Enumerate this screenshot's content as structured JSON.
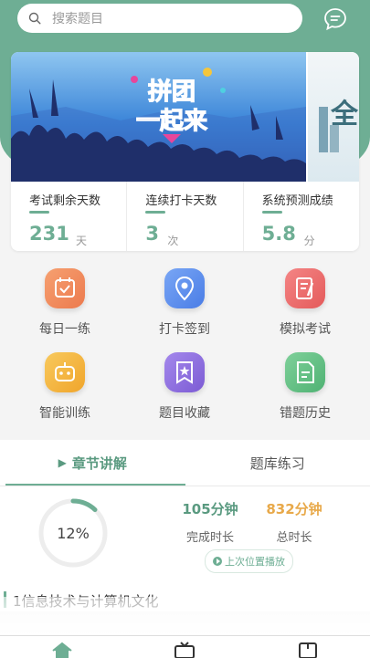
{
  "search": {
    "placeholder": "搜索题目"
  },
  "banner": {
    "line1": "拼团",
    "line2": "一起来",
    "side_text": "全"
  },
  "stats": [
    {
      "label": "考试剩余天数",
      "value": "231",
      "unit": "天"
    },
    {
      "label": "连续打卡天数",
      "value": "3",
      "unit": "次"
    },
    {
      "label": "系统预测成绩",
      "value": "5.8",
      "unit": "分"
    }
  ],
  "features": [
    {
      "label": "每日一练",
      "icon": "calendar-icon",
      "color": "#f08a5d"
    },
    {
      "label": "打卡签到",
      "icon": "location-pin-icon",
      "color": "#5b8def"
    },
    {
      "label": "模拟考试",
      "icon": "exam-paper-icon",
      "color": "#ef6b6b"
    },
    {
      "label": "智能训练",
      "icon": "robot-icon",
      "color": "#f5b53d"
    },
    {
      "label": "题目收藏",
      "icon": "bookmark-star-icon",
      "color": "#8a6bde"
    },
    {
      "label": "错题历史",
      "icon": "document-icon",
      "color": "#5cbf7e"
    }
  ],
  "tabs": [
    {
      "label": "章节讲解",
      "active": true
    },
    {
      "label": "题库练习",
      "active": false
    }
  ],
  "progress": {
    "percent_text": "12%",
    "percent": 12,
    "done_value": "105分钟",
    "done_label": "完成时长",
    "total_value": "832分钟",
    "total_label": "总时长",
    "resume_label": "上次位置播放"
  },
  "chapter": {
    "title": "1信息技术与计算机文化"
  },
  "colors": {
    "accent": "#6eae94",
    "orange": "#e8a94a"
  }
}
